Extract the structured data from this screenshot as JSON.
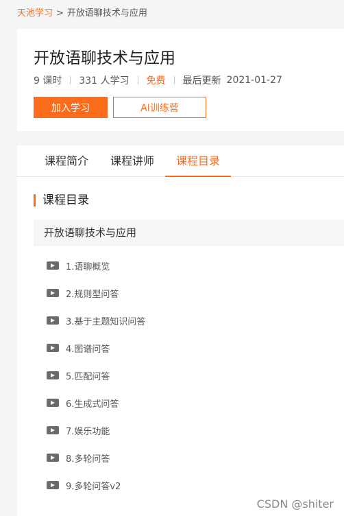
{
  "breadcrumb": {
    "home": "天池学习",
    "separator": ">",
    "current": "开放语聊技术与应用"
  },
  "course": {
    "title": "开放语聊技术与应用",
    "lessons_count": "9 课时",
    "learners": "331 人学习",
    "price": "免费",
    "updated_label": "最后更新",
    "updated_date": "2021-01-27"
  },
  "actions": {
    "join_label": "加入学习",
    "camp_label": "AI训练营"
  },
  "tabs": [
    {
      "label": "课程简介",
      "active": false
    },
    {
      "label": "课程讲师",
      "active": false
    },
    {
      "label": "课程目录",
      "active": true
    }
  ],
  "catalog": {
    "section_title": "课程目录",
    "chapter": "开放语聊技术与应用",
    "lessons": [
      {
        "label": "1.语聊概览",
        "icon": "video-play-icon"
      },
      {
        "label": "2.规则型问答",
        "icon": "video-play-icon"
      },
      {
        "label": "3.基于主题知识问答",
        "icon": "video-play-icon"
      },
      {
        "label": "4.图谱问答",
        "icon": "video-play-icon"
      },
      {
        "label": "5.匹配问答",
        "icon": "video-play-icon"
      },
      {
        "label": "6.生成式问答",
        "icon": "video-play-icon"
      },
      {
        "label": "7.娱乐功能",
        "icon": "video-play-icon"
      },
      {
        "label": "8.多轮问答",
        "icon": "video-play-icon"
      },
      {
        "label": "9.多轮问答v2",
        "icon": "video-play-icon"
      }
    ]
  },
  "watermark": "CSDN @shiter",
  "colors": {
    "accent": "#fc6d1b",
    "background": "#f5f5f5",
    "icon_gray": "#6b6b6b"
  }
}
